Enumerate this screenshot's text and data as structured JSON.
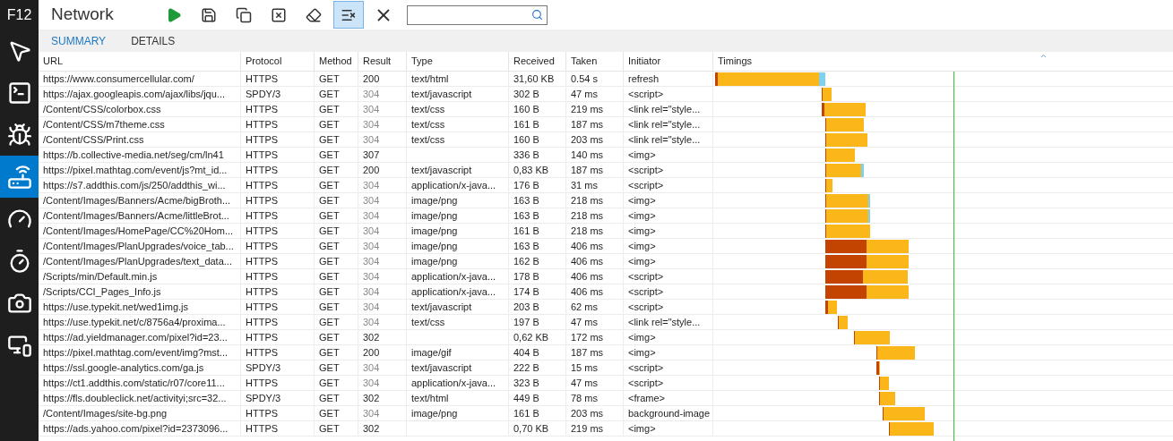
{
  "sidebar": {
    "title": "F12",
    "items": [
      {
        "kind": "dom",
        "selected": false
      },
      {
        "kind": "console",
        "selected": false
      },
      {
        "kind": "debugger",
        "selected": false
      },
      {
        "kind": "network",
        "selected": true
      },
      {
        "kind": "performance",
        "selected": false
      },
      {
        "kind": "memory",
        "selected": false
      },
      {
        "kind": "emulation",
        "selected": false
      },
      {
        "kind": "devices",
        "selected": false
      }
    ]
  },
  "toolbar": {
    "title": "Network",
    "buttons": [
      {
        "kind": "start",
        "selected": false
      },
      {
        "kind": "export",
        "selected": false
      },
      {
        "kind": "cache",
        "selected": false
      },
      {
        "kind": "clear-cache",
        "selected": false
      },
      {
        "kind": "clear-cookies",
        "selected": false
      },
      {
        "kind": "clear-entries",
        "selected": true
      },
      {
        "kind": "close",
        "selected": false
      }
    ]
  },
  "tabs": [
    {
      "label": "SUMMARY",
      "selected": true
    },
    {
      "label": "DETAILS",
      "selected": false
    }
  ],
  "table": {
    "columns": [
      "URL",
      "Protocol",
      "Method",
      "Result",
      "Type",
      "Received",
      "Taken",
      "Initiator",
      "Timings"
    ],
    "rows": [
      {
        "url": "https://www.consumercellular.com/",
        "protocol": "HTTPS",
        "method": "GET",
        "result": "200",
        "cached": false,
        "type": "text/html",
        "received": "31,60 KB",
        "taken": "0.54 s",
        "initiator": "refresh"
      },
      {
        "url": "https://ajax.googleapis.com/ajax/libs/jqu...",
        "protocol": "SPDY/3",
        "method": "GET",
        "result": "304",
        "cached": true,
        "type": "text/javascript",
        "received": "302 B",
        "taken": "47 ms",
        "initiator": "<script>"
      },
      {
        "url": "/Content/CSS/colorbox.css",
        "protocol": "HTTPS",
        "method": "GET",
        "result": "304",
        "cached": true,
        "type": "text/css",
        "received": "160 B",
        "taken": "219 ms",
        "initiator": "<link rel=\"style..."
      },
      {
        "url": "/Content/CSS/m7theme.css",
        "protocol": "HTTPS",
        "method": "GET",
        "result": "304",
        "cached": true,
        "type": "text/css",
        "received": "161 B",
        "taken": "187 ms",
        "initiator": "<link rel=\"style..."
      },
      {
        "url": "/Content/CSS/Print.css",
        "protocol": "HTTPS",
        "method": "GET",
        "result": "304",
        "cached": true,
        "type": "text/css",
        "received": "160 B",
        "taken": "203 ms",
        "initiator": "<link rel=\"style..."
      },
      {
        "url": "https://b.collective-media.net/seg/cm/ln41",
        "protocol": "HTTPS",
        "method": "GET",
        "result": "307",
        "cached": false,
        "received": "336 B",
        "taken": "140 ms",
        "initiator": "<img>"
      },
      {
        "url": "https://pixel.mathtag.com/event/js?mt_id...",
        "protocol": "HTTPS",
        "method": "GET",
        "result": "200",
        "cached": false,
        "type": "text/javascript",
        "received": "0,83 KB",
        "taken": "187 ms",
        "initiator": "<script>"
      },
      {
        "url": "https://s7.addthis.com/js/250/addthis_wi...",
        "protocol": "HTTPS",
        "method": "GET",
        "result": "304",
        "cached": true,
        "type": "application/x-java...",
        "received": "176 B",
        "taken": "31 ms",
        "initiator": "<script>"
      },
      {
        "url": "/Content/Images/Banners/Acme/bigBroth...",
        "protocol": "HTTPS",
        "method": "GET",
        "result": "304",
        "cached": true,
        "type": "image/png",
        "received": "163 B",
        "taken": "218 ms",
        "initiator": "<img>"
      },
      {
        "url": "/Content/Images/Banners/Acme/littleBrot...",
        "protocol": "HTTPS",
        "method": "GET",
        "result": "304",
        "cached": true,
        "type": "image/png",
        "received": "163 B",
        "taken": "218 ms",
        "initiator": "<img>"
      },
      {
        "url": "/Content/Images/HomePage/CC%20Hom...",
        "protocol": "HTTPS",
        "method": "GET",
        "result": "304",
        "cached": true,
        "type": "image/png",
        "received": "161 B",
        "taken": "218 ms",
        "initiator": "<img>"
      },
      {
        "url": "/Content/Images/PlanUpgrades/voice_tab...",
        "protocol": "HTTPS",
        "method": "GET",
        "result": "304",
        "cached": true,
        "type": "image/png",
        "received": "163 B",
        "taken": "406 ms",
        "initiator": "<img>"
      },
      {
        "url": "/Content/Images/PlanUpgrades/text_data...",
        "protocol": "HTTPS",
        "method": "GET",
        "result": "304",
        "cached": true,
        "type": "image/png",
        "received": "162 B",
        "taken": "406 ms",
        "initiator": "<img>"
      },
      {
        "url": "/Scripts/min/Default.min.js",
        "protocol": "HTTPS",
        "method": "GET",
        "result": "304",
        "cached": true,
        "type": "application/x-java...",
        "received": "178 B",
        "taken": "406 ms",
        "initiator": "<script>"
      },
      {
        "url": "/Scripts/CCI_Pages_Info.js",
        "protocol": "HTTPS",
        "method": "GET",
        "result": "304",
        "cached": true,
        "type": "application/x-java...",
        "received": "174 B",
        "taken": "406 ms",
        "initiator": "<script>"
      },
      {
        "url": "https://use.typekit.net/wed1img.js",
        "protocol": "HTTPS",
        "method": "GET",
        "result": "304",
        "cached": true,
        "type": "text/javascript",
        "received": "203 B",
        "taken": "62 ms",
        "initiator": "<script>"
      },
      {
        "url": "https://use.typekit.net/c/8756a4/proxima...",
        "protocol": "HTTPS",
        "method": "GET",
        "result": "304",
        "cached": true,
        "type": "text/css",
        "received": "197 B",
        "taken": "47 ms",
        "initiator": "<link rel=\"style..."
      },
      {
        "url": "https://ad.yieldmanager.com/pixel?id=23...",
        "protocol": "HTTPS",
        "method": "GET",
        "result": "302",
        "cached": false,
        "received": "0,62 KB",
        "taken": "172 ms",
        "initiator": "<img>"
      },
      {
        "url": "https://pixel.mathtag.com/event/img?mst...",
        "protocol": "HTTPS",
        "method": "GET",
        "result": "200",
        "cached": false,
        "type": "image/gif",
        "received": "404 B",
        "taken": "187 ms",
        "initiator": "<img>"
      },
      {
        "url": "https://ssl.google-analytics.com/ga.js",
        "protocol": "SPDY/3",
        "method": "GET",
        "result": "304",
        "cached": true,
        "type": "text/javascript",
        "received": "222 B",
        "taken": "15 ms",
        "initiator": "<script>"
      },
      {
        "url": "https://ct1.addthis.com/static/r07/core11...",
        "protocol": "HTTPS",
        "method": "GET",
        "result": "304",
        "cached": true,
        "type": "application/x-java...",
        "received": "323 B",
        "taken": "47 ms",
        "initiator": "<script>"
      },
      {
        "url": "https://fls.doubleclick.net/activityi;src=32...",
        "protocol": "SPDY/3",
        "method": "GET",
        "result": "302",
        "cached": false,
        "type": "text/html",
        "received": "449 B",
        "taken": "78 ms",
        "initiator": "<frame>"
      },
      {
        "url": "/Content/Images/site-bg.png",
        "protocol": "HTTPS",
        "method": "GET",
        "result": "304",
        "cached": true,
        "type": "image/png",
        "received": "161 B",
        "taken": "203 ms",
        "initiator": "background-image"
      },
      {
        "url": "https://ads.yahoo.com/pixel?id=2373096...",
        "protocol": "HTTPS",
        "method": "GET",
        "result": "302",
        "cached": false,
        "received": "0,70 KB",
        "taken": "219 ms",
        "initiator": "<img>"
      }
    ]
  }
}
